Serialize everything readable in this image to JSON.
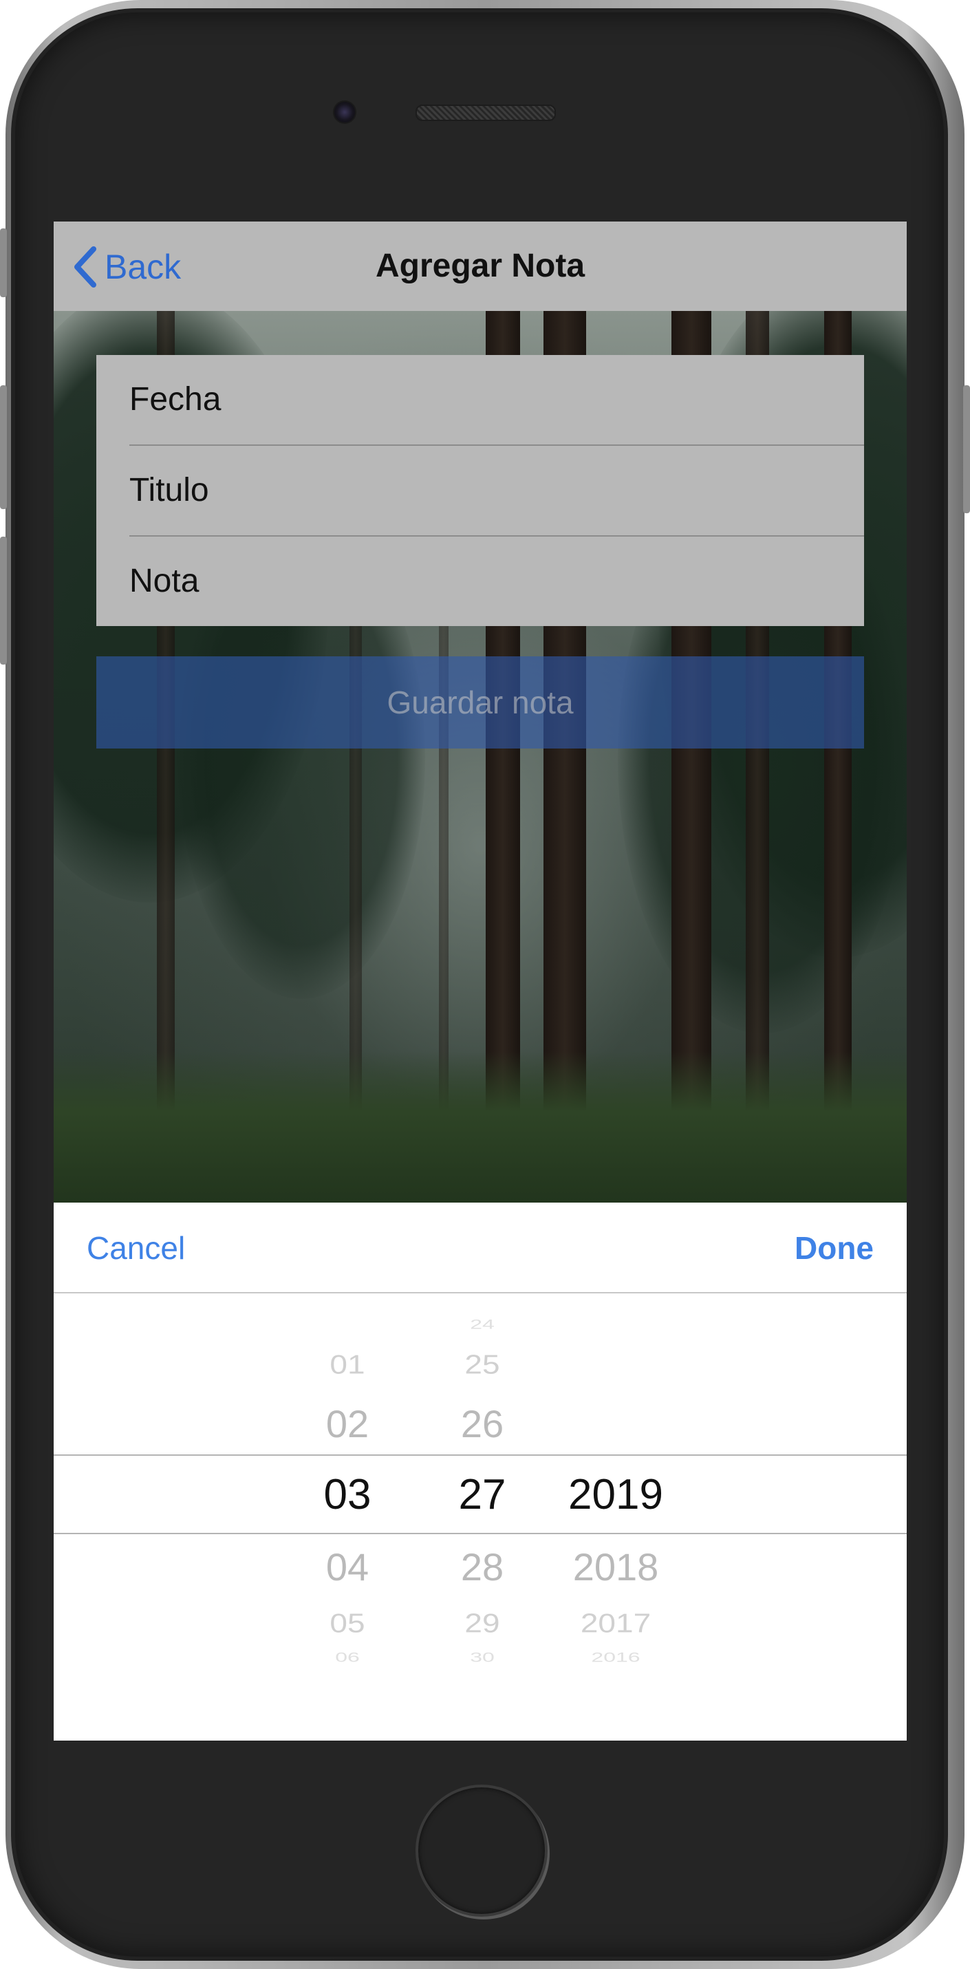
{
  "navbar": {
    "back_label": "Back",
    "title": "Agregar Nota"
  },
  "form": {
    "fields": [
      {
        "placeholder": "Fecha"
      },
      {
        "placeholder": "Titulo"
      },
      {
        "placeholder": "Nota"
      }
    ],
    "save_label": "Guardar nota"
  },
  "picker": {
    "cancel_label": "Cancel",
    "done_label": "Done",
    "month": {
      "above": [
        "",
        "01",
        "02"
      ],
      "selected": "03",
      "below": [
        "04",
        "05",
        "06"
      ]
    },
    "day": {
      "above": [
        "24",
        "25",
        "26"
      ],
      "selected": "27",
      "below": [
        "28",
        "29",
        "30"
      ]
    },
    "year": {
      "above": [
        "",
        "",
        ""
      ],
      "selected": "2019",
      "below": [
        "2018",
        "2017",
        "2016"
      ]
    }
  },
  "colors": {
    "accent": "#3f82e6",
    "navbar_bg": "#b8b8b8",
    "save_button_bg": "#3058aa"
  }
}
